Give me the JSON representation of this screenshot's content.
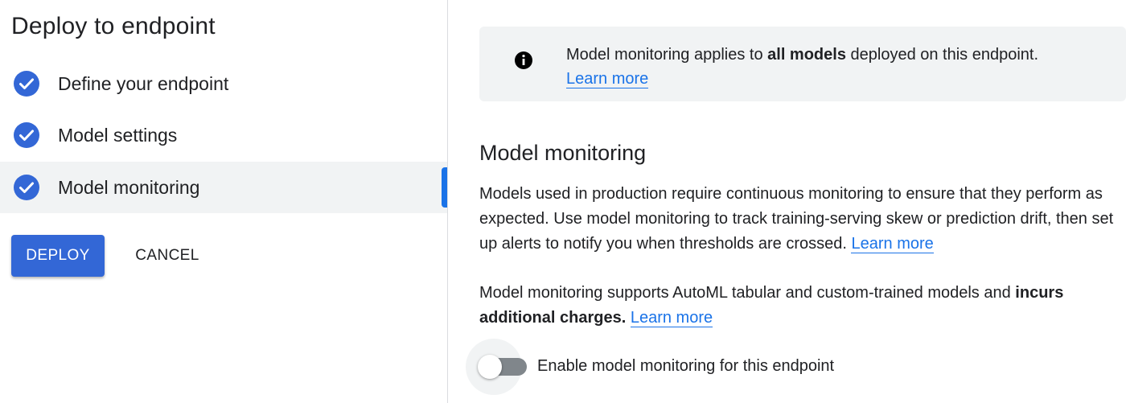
{
  "sidebar": {
    "title": "Deploy to endpoint",
    "steps": [
      {
        "label": "Define your endpoint",
        "icon": "check-circle-icon",
        "status": "complete"
      },
      {
        "label": "Model settings",
        "icon": "check-circle-icon",
        "status": "complete"
      },
      {
        "label": "Model monitoring",
        "icon": "check-circle-icon",
        "status": "complete-active"
      }
    ],
    "deploy_label": "DEPLOY",
    "cancel_label": "CANCEL"
  },
  "info": {
    "icon": "info-icon",
    "text_before": "Model monitoring applies to ",
    "text_bold": "all models",
    "text_after": " deployed on this endpoint.",
    "link": "Learn more"
  },
  "main": {
    "title": "Model monitoring",
    "para1_text": "Models used in production require continuous monitoring to ensure that they perform as expected. Use model monitoring to track training-serving skew or prediction drift, then set up alerts to notify you when thresholds are crossed.",
    "para1_link": "Learn more",
    "para2_text": "Model monitoring supports AutoML tabular and custom-trained models and ",
    "para2_bold": "incurs additional charges.",
    "para2_link": "Learn more",
    "toggle_label": "Enable model monitoring for this endpoint",
    "toggle_on": false
  },
  "colors": {
    "accent": "#1a73e8",
    "deploy_button": "#3367d6",
    "check": "#3367d6",
    "info_bg": "#f1f3f4"
  }
}
